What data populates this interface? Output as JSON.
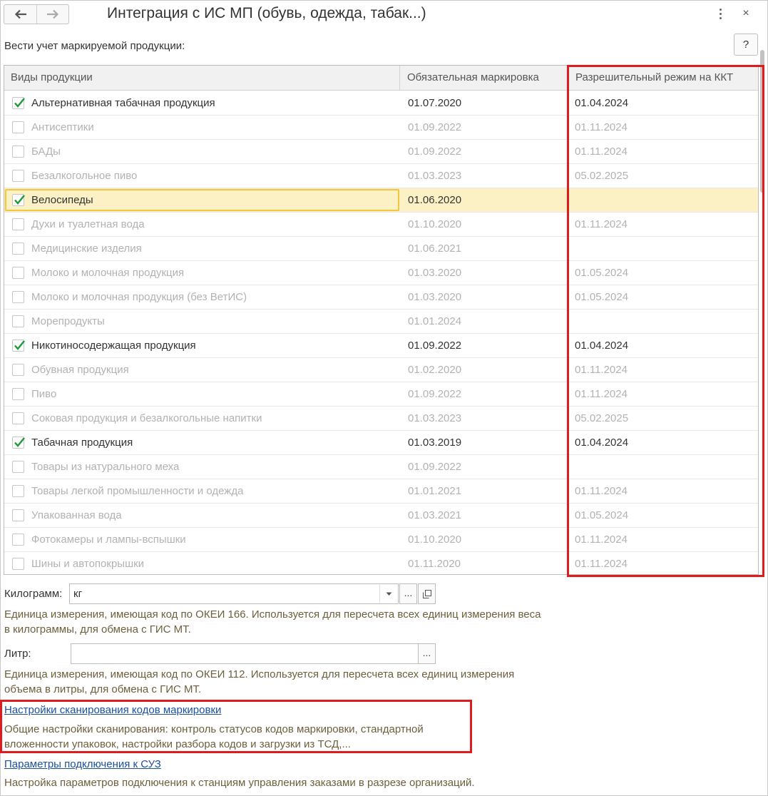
{
  "window": {
    "title": "Интеграция с ИС МП (обувь, одежда, табак...)",
    "close_glyph": "×",
    "help_label": "?"
  },
  "intro_label": "Вести учет маркируемой продукции:",
  "table": {
    "columns": [
      "Виды продукции",
      "Обязательная маркировка",
      "Разрешительный режим на ККТ"
    ],
    "rows": [
      {
        "name": "Альтернативная табачная продукция",
        "mandatory": "01.07.2020",
        "permissive": "01.04.2024",
        "checked": true
      },
      {
        "name": "Антисептики",
        "mandatory": "01.09.2022",
        "permissive": "01.11.2024",
        "checked": false
      },
      {
        "name": "БАДы",
        "mandatory": "01.09.2022",
        "permissive": "01.11.2024",
        "checked": false
      },
      {
        "name": "Безалкогольное пиво",
        "mandatory": "01.03.2023",
        "permissive": "05.02.2025",
        "checked": false
      },
      {
        "name": "Велосипеды",
        "mandatory": "01.06.2020",
        "permissive": "",
        "checked": true,
        "selected": true
      },
      {
        "name": "Духи и туалетная вода",
        "mandatory": "01.10.2020",
        "permissive": "01.11.2024",
        "checked": false
      },
      {
        "name": "Медицинские изделия",
        "mandatory": "01.06.2021",
        "permissive": "",
        "checked": false
      },
      {
        "name": "Молоко и молочная продукция",
        "mandatory": "01.03.2020",
        "permissive": "01.05.2024",
        "checked": false
      },
      {
        "name": "Молоко и молочная продукция (без ВетИС)",
        "mandatory": "01.03.2020",
        "permissive": "01.05.2024",
        "checked": false
      },
      {
        "name": "Морепродукты",
        "mandatory": "01.01.2024",
        "permissive": "",
        "checked": false
      },
      {
        "name": "Никотиносодержащая продукция",
        "mandatory": "01.09.2022",
        "permissive": "01.04.2024",
        "checked": true
      },
      {
        "name": "Обувная продукция",
        "mandatory": "01.02.2020",
        "permissive": "01.11.2024",
        "checked": false
      },
      {
        "name": "Пиво",
        "mandatory": "01.09.2022",
        "permissive": "01.11.2024",
        "checked": false
      },
      {
        "name": "Соковая продукция и безалкогольные напитки",
        "mandatory": "01.03.2023",
        "permissive": "05.02.2025",
        "checked": false
      },
      {
        "name": "Табачная продукция",
        "mandatory": "01.03.2019",
        "permissive": "01.04.2024",
        "checked": true
      },
      {
        "name": "Товары из натурального меха",
        "mandatory": "01.09.2022",
        "permissive": "",
        "checked": false
      },
      {
        "name": "Товары легкой промышленности и одежда",
        "mandatory": "01.01.2021",
        "permissive": "01.11.2024",
        "checked": false
      },
      {
        "name": "Упакованная вода",
        "mandatory": "01.03.2021",
        "permissive": "01.05.2024",
        "checked": false
      },
      {
        "name": "Фотокамеры и лампы-вспышки",
        "mandatory": "01.10.2020",
        "permissive": "01.11.2024",
        "checked": false
      },
      {
        "name": "Шины и автопокрышки",
        "mandatory": "01.11.2020",
        "permissive": "01.11.2024",
        "checked": false
      }
    ]
  },
  "kilogram": {
    "label": "Килограмм:",
    "value": "кг",
    "select_label": "...",
    "note": "Единица измерения, имеющая код по ОКЕИ 166. Используется для пересчета всех единиц измерения веса в килограммы, для обмена с ГИС МТ."
  },
  "liter": {
    "label": "Литр:",
    "value": "",
    "select_label": "...",
    "note": "Единица измерения, имеющая код по ОКЕИ 112. Используется для пересчета всех единиц измерения объема в литры, для обмена с ГИС МТ."
  },
  "scan_settings": {
    "link": "Настройки сканирования кодов маркировки",
    "note": "Общие настройки сканирования: контроль статусов кодов маркировки, стандартной вложенности упаковок, настройки разбора кодов и загрузки из ТСД,..."
  },
  "suz": {
    "link": "Параметры подключения к СУЗ",
    "note": "Настройка параметров подключения к станциям управления заказами в разрезе организаций."
  },
  "colors": {
    "highlight_red": "#e01b1b",
    "check_green": "#1f9a3a",
    "selected_row": "#fbf1c5",
    "focus_border": "#f2c63d",
    "link_blue": "#1c4f9c",
    "note_brown": "#6d5f3c"
  }
}
